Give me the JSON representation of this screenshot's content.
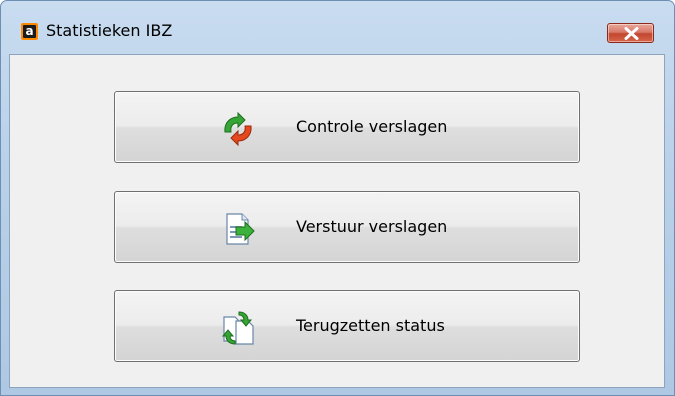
{
  "window": {
    "title": "Statistieken IBZ",
    "app_icon_letter": "a",
    "close_icon": "close-icon"
  },
  "buttons": [
    {
      "label": "Controle verslagen",
      "icon": "refresh-arrows-icon"
    },
    {
      "label": "Verstuur verslagen",
      "icon": "send-document-icon"
    },
    {
      "label": "Terugzetten status",
      "icon": "reset-status-icon"
    }
  ],
  "colors": {
    "close_button": "#c8503a",
    "app_icon": "#ff8a00",
    "arrow_green": "#2f9e2f",
    "arrow_red": "#e2421e"
  }
}
